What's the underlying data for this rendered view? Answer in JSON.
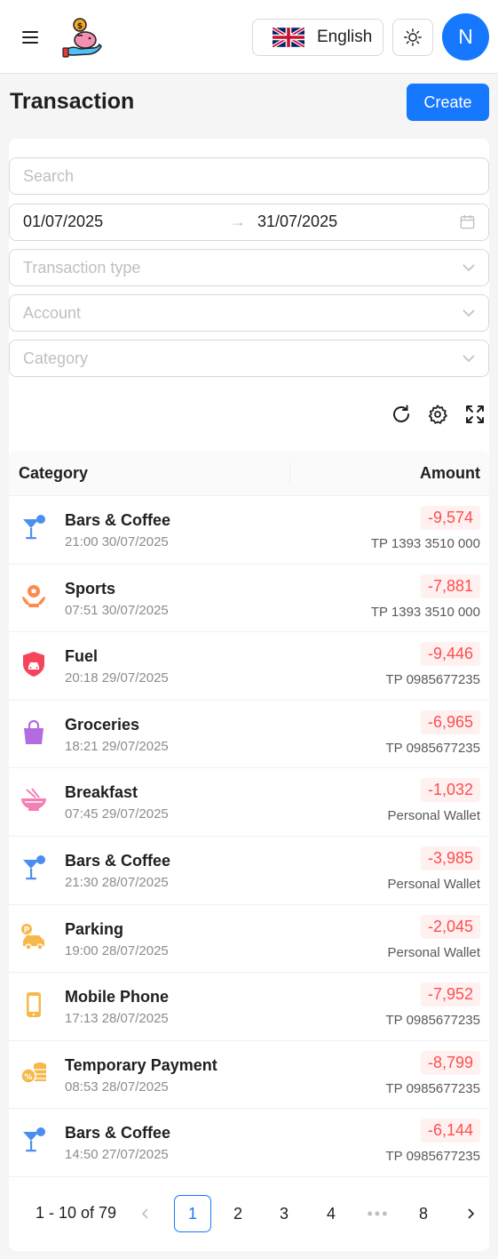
{
  "header": {
    "language_label": "English",
    "avatar_initial": "N"
  },
  "page": {
    "title": "Transaction",
    "create_label": "Create"
  },
  "filters": {
    "search_placeholder": "Search",
    "date_start": "01/07/2025",
    "date_arrow": "→",
    "date_end": "31/07/2025",
    "transaction_type_placeholder": "Transaction type",
    "account_placeholder": "Account",
    "category_placeholder": "Category"
  },
  "table": {
    "col_category": "Category",
    "col_amount": "Amount",
    "rows": [
      {
        "name": "Bars & Coffee",
        "time": "21:00 30/07/2025",
        "amount": "-9,574",
        "account": "TP 1393 3510 000",
        "icon": "cocktail-icon"
      },
      {
        "name": "Sports",
        "time": "07:51 30/07/2025",
        "amount": "-7,881",
        "account": "TP 1393 3510 000",
        "icon": "sports-ball-icon"
      },
      {
        "name": "Fuel",
        "time": "20:18 29/07/2025",
        "amount": "-9,446",
        "account": "TP 0985677235",
        "icon": "car-shield-icon"
      },
      {
        "name": "Groceries",
        "time": "18:21 29/07/2025",
        "amount": "-6,965",
        "account": "TP 0985677235",
        "icon": "shopping-bag-icon"
      },
      {
        "name": "Breakfast",
        "time": "07:45 29/07/2025",
        "amount": "-1,032",
        "account": "Personal Wallet",
        "icon": "noodle-bowl-icon"
      },
      {
        "name": "Bars & Coffee",
        "time": "21:30 28/07/2025",
        "amount": "-3,985",
        "account": "Personal Wallet",
        "icon": "cocktail-icon"
      },
      {
        "name": "Parking",
        "time": "19:00 28/07/2025",
        "amount": "-2,045",
        "account": "Personal Wallet",
        "icon": "parking-car-icon"
      },
      {
        "name": "Mobile Phone",
        "time": "17:13 28/07/2025",
        "amount": "-7,952",
        "account": "TP 0985677235",
        "icon": "mobile-phone-icon"
      },
      {
        "name": "Temporary Payment",
        "time": "08:53 28/07/2025",
        "amount": "-8,799",
        "account": "TP 0985677235",
        "icon": "coins-icon"
      },
      {
        "name": "Bars & Coffee",
        "time": "14:50 27/07/2025",
        "amount": "-6,144",
        "account": "TP 0985677235",
        "icon": "cocktail-icon"
      }
    ]
  },
  "pagination": {
    "total_label": "1 - 10 of 79",
    "pages": [
      "1",
      "2",
      "3",
      "4",
      "8"
    ],
    "current_page": "1",
    "dots": "•••"
  },
  "colors": {
    "primary": "#1677ff",
    "amount_negative": "#ff4d4f",
    "amount_bg": "#fff1f0"
  }
}
